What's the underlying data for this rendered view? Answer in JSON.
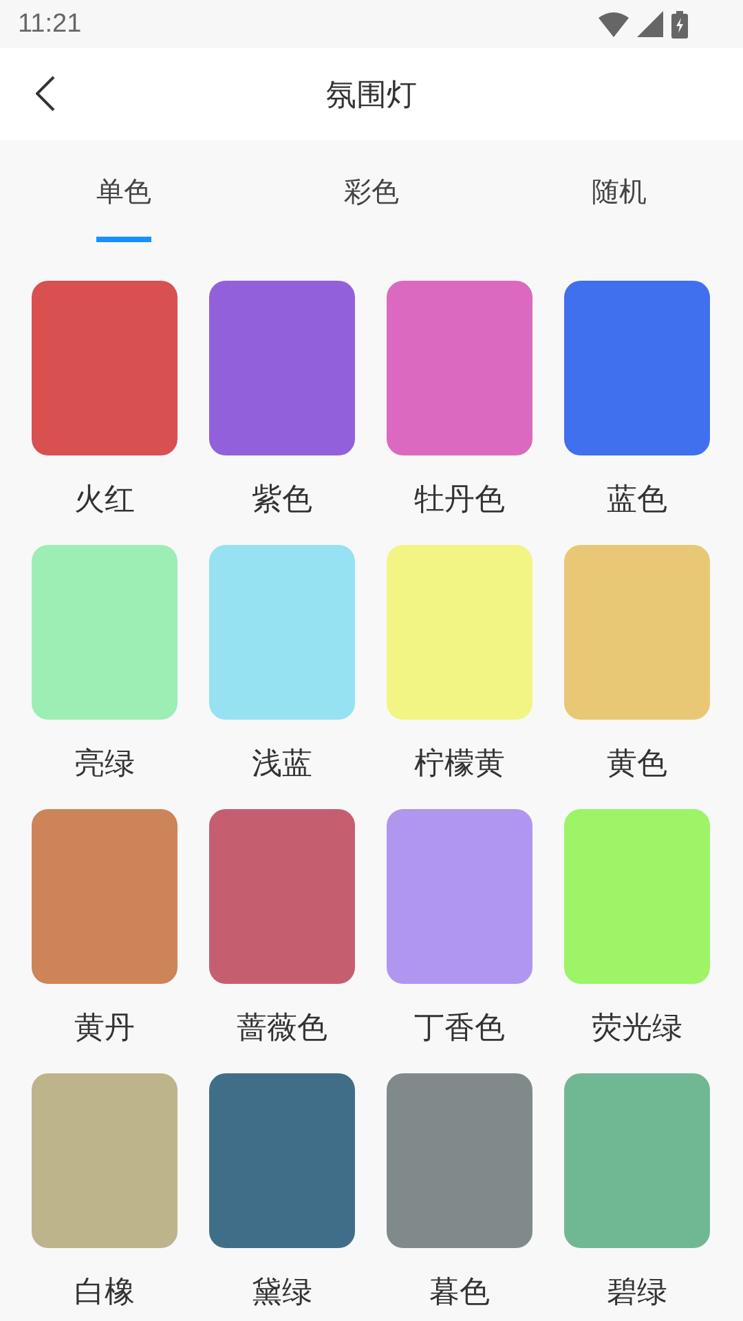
{
  "status_bar": {
    "time": "11:21"
  },
  "header": {
    "title": "氛围灯"
  },
  "tabs": [
    {
      "label": "单色",
      "selected": true
    },
    {
      "label": "彩色",
      "selected": false
    },
    {
      "label": "随机",
      "selected": false
    }
  ],
  "colors": [
    {
      "name": "火红",
      "color": "#d85050"
    },
    {
      "name": "紫色",
      "color": "#9360dc"
    },
    {
      "name": "牡丹色",
      "color": "#dc69c0"
    },
    {
      "name": "蓝色",
      "color": "#4070ee"
    },
    {
      "name": "亮绿",
      "color": "#9deeb4"
    },
    {
      "name": "浅蓝",
      "color": "#96e2f2"
    },
    {
      "name": "柠檬黄",
      "color": "#f2f484"
    },
    {
      "name": "黄色",
      "color": "#e8c874"
    },
    {
      "name": "黄丹",
      "color": "#cd8458"
    },
    {
      "name": "蔷薇色",
      "color": "#c55f70"
    },
    {
      "name": "丁香色",
      "color": "#b096ef"
    },
    {
      "name": "荧光绿",
      "color": "#9cf466"
    },
    {
      "name": "白橡",
      "color": "#bdb48c"
    },
    {
      "name": "黛绿",
      "color": "#406e88"
    },
    {
      "name": "暮色",
      "color": "#808a8a"
    },
    {
      "name": "碧绿",
      "color": "#70b894"
    }
  ]
}
